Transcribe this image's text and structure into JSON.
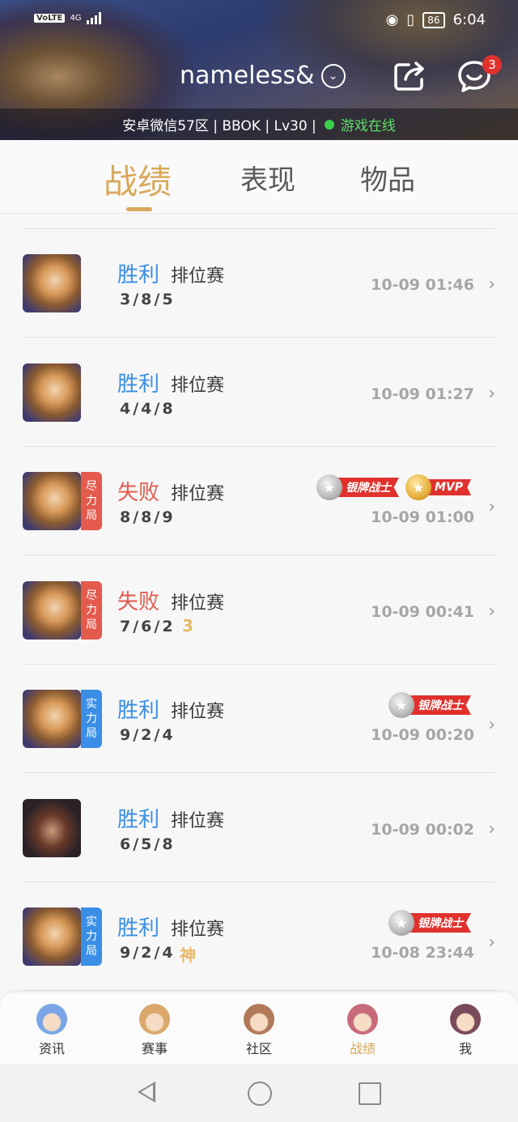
{
  "status_bar": {
    "volte": "VoLTE",
    "network": "4G",
    "battery": "86",
    "time": "6:04"
  },
  "header": {
    "nickname": "nameless&",
    "notification_count": "3",
    "info_text": "安卓微信57区 | BBOK | Lv30 |",
    "online_text": "游戏在线"
  },
  "tabs": [
    {
      "label": "战绩",
      "active": true
    },
    {
      "label": "表现",
      "active": false
    },
    {
      "label": "物品",
      "active": false
    }
  ],
  "matches": [
    {
      "result": "胜利",
      "mode": "排位赛",
      "kda": "3/8/5",
      "time": "10-09 01:46",
      "hero": "av-hero",
      "tag": "",
      "extra": "",
      "badges": []
    },
    {
      "result": "胜利",
      "mode": "排位赛",
      "kda": "4/4/8",
      "time": "10-09 01:27",
      "hero": "av-hero",
      "tag": "",
      "extra": "",
      "badges": []
    },
    {
      "result": "失败",
      "mode": "排位赛",
      "kda": "8/8/9",
      "time": "10-09 01:00",
      "hero": "av-hero",
      "tag": "尽力局",
      "extra": "",
      "badges": [
        "银牌战士",
        "MVP"
      ]
    },
    {
      "result": "失败",
      "mode": "排位赛",
      "kda": "7/6/2",
      "time": "10-09 00:41",
      "hero": "av-hero",
      "tag": "尽力局",
      "extra": "3",
      "badges": []
    },
    {
      "result": "胜利",
      "mode": "排位赛",
      "kda": "9/2/4",
      "time": "10-09 00:20",
      "hero": "av-hero",
      "tag": "实力局",
      "extra": "",
      "badges": [
        "银牌战士"
      ]
    },
    {
      "result": "胜利",
      "mode": "排位赛",
      "kda": "6/5/8",
      "time": "10-09 00:02",
      "hero": "av-hero2",
      "tag": "",
      "extra": "",
      "badges": []
    },
    {
      "result": "胜利",
      "mode": "排位赛",
      "kda": "9/2/4",
      "time": "10-08 23:44",
      "hero": "av-hero",
      "tag": "实力局",
      "extra": "神",
      "badges": [
        "银牌战士"
      ]
    }
  ],
  "bottom_nav": [
    {
      "label": "资讯",
      "icon": "news-avatar-icon",
      "color": "#7aa6e8",
      "active": false
    },
    {
      "label": "赛事",
      "icon": "events-avatar-icon",
      "color": "#d9a86a",
      "active": false
    },
    {
      "label": "社区",
      "icon": "community-avatar-icon",
      "color": "#b07a5a",
      "active": false
    },
    {
      "label": "战绩",
      "icon": "records-avatar-icon",
      "color": "#c76a7a",
      "active": true
    },
    {
      "label": "我",
      "icon": "me-avatar-icon",
      "color": "#7a4a5a",
      "active": false
    }
  ],
  "colors": {
    "accent": "#d8a85a",
    "win": "#3a8ee6",
    "lose": "#e45a4d",
    "online": "#3ad04a"
  }
}
